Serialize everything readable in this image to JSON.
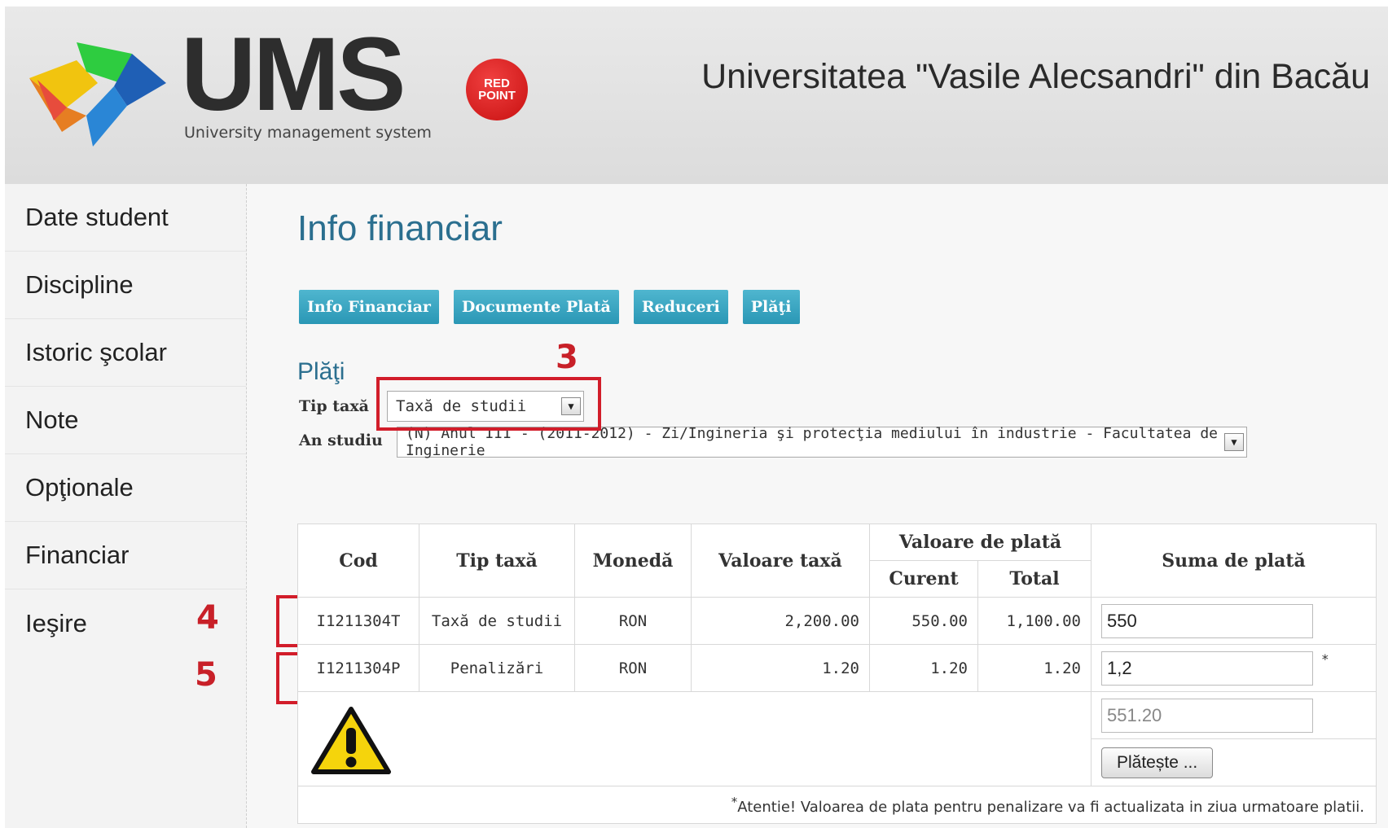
{
  "header": {
    "logo_text": "UMS",
    "logo_subtitle": "University management system",
    "badge_line1": "RED",
    "badge_line2": "POINT",
    "university": "Universitatea \"Vasile Alecsandri\" din Bacău"
  },
  "sidebar": {
    "items": [
      {
        "label": "Date student"
      },
      {
        "label": "Discipline"
      },
      {
        "label": "Istoric şcolar"
      },
      {
        "label": "Note"
      },
      {
        "label": "Opţionale"
      },
      {
        "label": "Financiar"
      },
      {
        "label": "Ieşire"
      }
    ]
  },
  "main": {
    "title": "Info financiar",
    "tabs": [
      {
        "label": "Info Financiar"
      },
      {
        "label": "Documente Plată"
      },
      {
        "label": "Reduceri"
      },
      {
        "label": "Plăţi"
      }
    ],
    "section_title": "Plăţi",
    "tip_taxa_label": "Tip taxă",
    "tip_taxa_value": "Taxă de studii",
    "an_studiu_label": "An studiu",
    "an_studiu_value": "(N) Anul III - (2011-2012) - Zi/Ingineria şi protecţia mediului în industrie - Facultatea de Inginerie"
  },
  "callouts": {
    "c3": "3",
    "c4": "4",
    "c5": "5"
  },
  "table": {
    "headers": {
      "cod": "Cod",
      "tip_taxa": "Tip taxă",
      "moneda": "Monedă",
      "valoare_taxa": "Valoare taxă",
      "valoare_de_plata": "Valoare de plată",
      "curent": "Curent",
      "total": "Total",
      "suma_de_plata": "Suma de plată"
    },
    "rows": [
      {
        "cod": "I1211304T",
        "tip_taxa": "Taxă de studii",
        "moneda": "RON",
        "valoare_taxa": "2,200.00",
        "curent": "550.00",
        "total": "1,100.00",
        "suma": "550"
      },
      {
        "cod": "I1211304P",
        "tip_taxa": "Penalizări",
        "moneda": "RON",
        "valoare_taxa": "1.20",
        "curent": "1.20",
        "total": "1.20",
        "suma": "1,2"
      }
    ],
    "star": "*",
    "total_sum": "551.20",
    "pay_button": "Plătește ...",
    "note_star": "*",
    "note": "Atentie! Valoarea de plata pentru penalizare va fi actualizata in ziua urmatoare platii."
  },
  "colors": {
    "accent": "#2b6f8f",
    "tab": "#3aa6c2",
    "callout": "#d21d2a",
    "badge": "#d91c1c"
  },
  "icons": {
    "logo": "ums-logo-arrows",
    "warning": "warning-icon",
    "dropdown": "chevron-down-icon"
  }
}
